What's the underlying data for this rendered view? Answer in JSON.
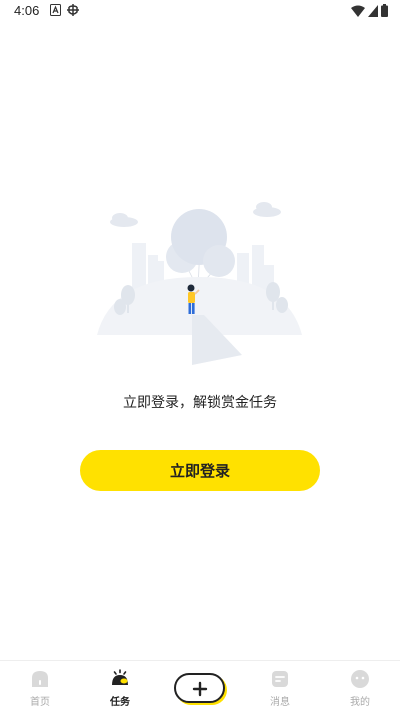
{
  "status_bar": {
    "time": "4:06",
    "left_icons": [
      "a-icon",
      "bug-icon"
    ],
    "right_icons": [
      "wifi-icon",
      "signal-icon",
      "battery-icon"
    ]
  },
  "main": {
    "hint": "立即登录，解锁赏金任务",
    "login_button_label": "立即登录"
  },
  "tab_bar": {
    "tabs": [
      {
        "label": "首页",
        "icon": "home-icon",
        "active": false
      },
      {
        "label": "任务",
        "icon": "task-icon",
        "active": true
      },
      {
        "label": "",
        "icon": "plus-icon",
        "active": false
      },
      {
        "label": "消息",
        "icon": "message-icon",
        "active": false
      },
      {
        "label": "我的",
        "icon": "profile-icon",
        "active": false
      }
    ]
  },
  "colors": {
    "accent": "#ffe100",
    "text": "#222222",
    "inactive": "#aaaaaa"
  }
}
